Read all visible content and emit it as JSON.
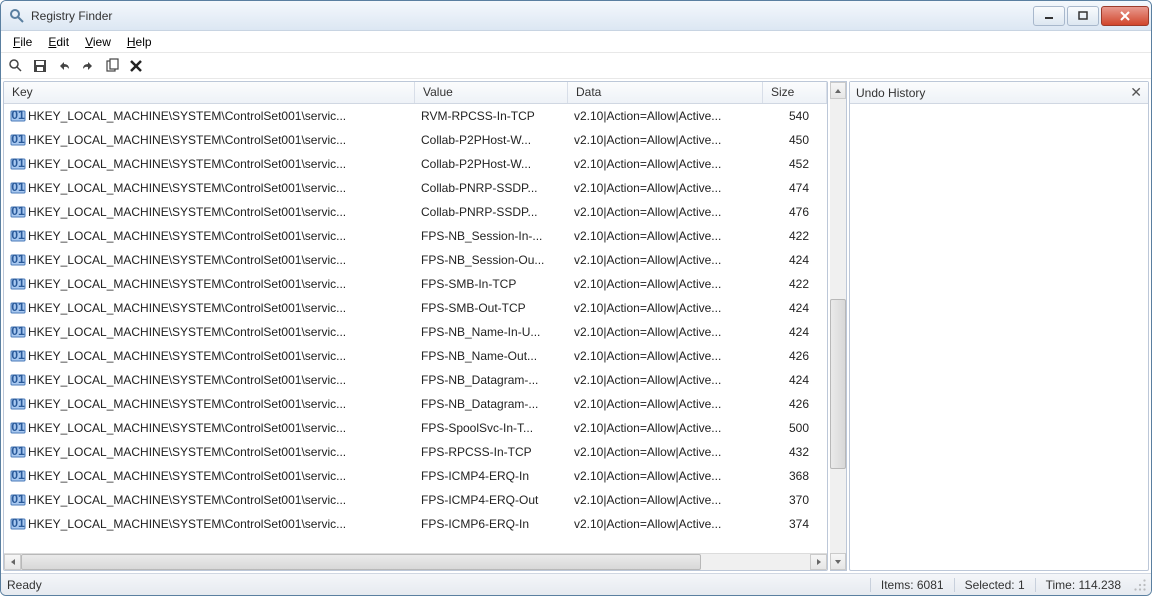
{
  "window": {
    "title": "Registry Finder"
  },
  "menu": {
    "file": "File",
    "edit": "Edit",
    "view": "View",
    "help": "Help"
  },
  "columns": {
    "key": "Key",
    "value": "Value",
    "data": "Data",
    "size": "Size"
  },
  "panel": {
    "title": "Undo History"
  },
  "status": {
    "ready": "Ready",
    "items": "Items: 6081",
    "selected": "Selected: 1",
    "time": "Time: 114.238"
  },
  "rows": [
    {
      "key": "HKEY_LOCAL_MACHINE\\SYSTEM\\ControlSet001\\servic...",
      "value": "RVM-RPCSS-In-TCP",
      "data": "v2.10|Action=Allow|Active...",
      "size": "540"
    },
    {
      "key": "HKEY_LOCAL_MACHINE\\SYSTEM\\ControlSet001\\servic...",
      "value": "Collab-P2PHost-W...",
      "data": "v2.10|Action=Allow|Active...",
      "size": "450"
    },
    {
      "key": "HKEY_LOCAL_MACHINE\\SYSTEM\\ControlSet001\\servic...",
      "value": "Collab-P2PHost-W...",
      "data": "v2.10|Action=Allow|Active...",
      "size": "452"
    },
    {
      "key": "HKEY_LOCAL_MACHINE\\SYSTEM\\ControlSet001\\servic...",
      "value": "Collab-PNRP-SSDP...",
      "data": "v2.10|Action=Allow|Active...",
      "size": "474"
    },
    {
      "key": "HKEY_LOCAL_MACHINE\\SYSTEM\\ControlSet001\\servic...",
      "value": "Collab-PNRP-SSDP...",
      "data": "v2.10|Action=Allow|Active...",
      "size": "476"
    },
    {
      "key": "HKEY_LOCAL_MACHINE\\SYSTEM\\ControlSet001\\servic...",
      "value": "FPS-NB_Session-In-...",
      "data": "v2.10|Action=Allow|Active...",
      "size": "422"
    },
    {
      "key": "HKEY_LOCAL_MACHINE\\SYSTEM\\ControlSet001\\servic...",
      "value": "FPS-NB_Session-Ou...",
      "data": "v2.10|Action=Allow|Active...",
      "size": "424"
    },
    {
      "key": "HKEY_LOCAL_MACHINE\\SYSTEM\\ControlSet001\\servic...",
      "value": "FPS-SMB-In-TCP",
      "data": "v2.10|Action=Allow|Active...",
      "size": "422"
    },
    {
      "key": "HKEY_LOCAL_MACHINE\\SYSTEM\\ControlSet001\\servic...",
      "value": "FPS-SMB-Out-TCP",
      "data": "v2.10|Action=Allow|Active...",
      "size": "424"
    },
    {
      "key": "HKEY_LOCAL_MACHINE\\SYSTEM\\ControlSet001\\servic...",
      "value": "FPS-NB_Name-In-U...",
      "data": "v2.10|Action=Allow|Active...",
      "size": "424"
    },
    {
      "key": "HKEY_LOCAL_MACHINE\\SYSTEM\\ControlSet001\\servic...",
      "value": "FPS-NB_Name-Out...",
      "data": "v2.10|Action=Allow|Active...",
      "size": "426"
    },
    {
      "key": "HKEY_LOCAL_MACHINE\\SYSTEM\\ControlSet001\\servic...",
      "value": "FPS-NB_Datagram-...",
      "data": "v2.10|Action=Allow|Active...",
      "size": "424"
    },
    {
      "key": "HKEY_LOCAL_MACHINE\\SYSTEM\\ControlSet001\\servic...",
      "value": "FPS-NB_Datagram-...",
      "data": "v2.10|Action=Allow|Active...",
      "size": "426"
    },
    {
      "key": "HKEY_LOCAL_MACHINE\\SYSTEM\\ControlSet001\\servic...",
      "value": "FPS-SpoolSvc-In-T...",
      "data": "v2.10|Action=Allow|Active...",
      "size": "500"
    },
    {
      "key": "HKEY_LOCAL_MACHINE\\SYSTEM\\ControlSet001\\servic...",
      "value": "FPS-RPCSS-In-TCP",
      "data": "v2.10|Action=Allow|Active...",
      "size": "432"
    },
    {
      "key": "HKEY_LOCAL_MACHINE\\SYSTEM\\ControlSet001\\servic...",
      "value": "FPS-ICMP4-ERQ-In",
      "data": "v2.10|Action=Allow|Active...",
      "size": "368"
    },
    {
      "key": "HKEY_LOCAL_MACHINE\\SYSTEM\\ControlSet001\\servic...",
      "value": "FPS-ICMP4-ERQ-Out",
      "data": "v2.10|Action=Allow|Active...",
      "size": "370"
    },
    {
      "key": "HKEY_LOCAL_MACHINE\\SYSTEM\\ControlSet001\\servic...",
      "value": "FPS-ICMP6-ERQ-In",
      "data": "v2.10|Action=Allow|Active...",
      "size": "374"
    }
  ]
}
